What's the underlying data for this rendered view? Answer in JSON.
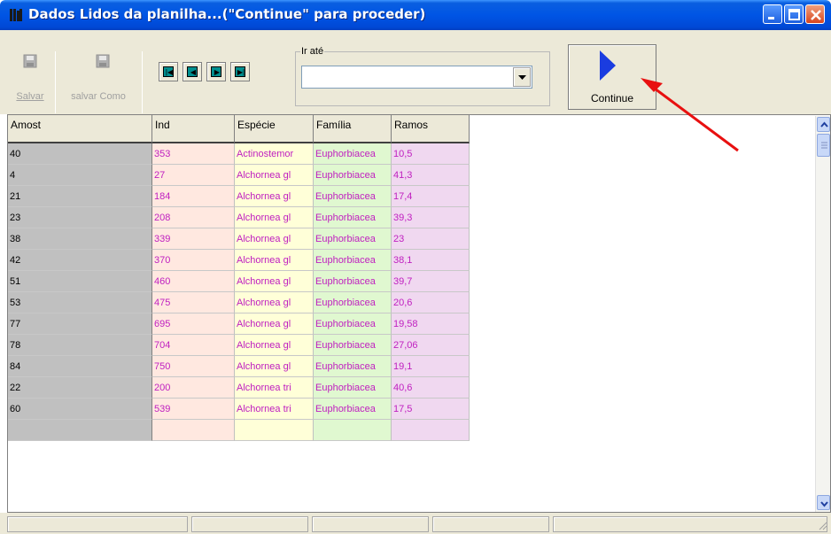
{
  "window": {
    "title": "Dados Lidos da planilha...(\"Continue\" para proceder)"
  },
  "toolbar": {
    "save_label": "Salvar",
    "save_as_label": "salvar Como",
    "goto_label": "Ir até",
    "goto_value": "",
    "continue_label": "Continue"
  },
  "grid": {
    "columns": [
      "Amost",
      "Ind",
      "Espécie",
      "Família",
      "Ramos"
    ],
    "rows": [
      [
        "40",
        "353",
        "Actinostemor",
        "Euphorbiacea",
        "10,5"
      ],
      [
        "4",
        "27",
        "Alchornea gl",
        "Euphorbiacea",
        "41,3"
      ],
      [
        "21",
        "184",
        "Alchornea gl",
        "Euphorbiacea",
        "17,4"
      ],
      [
        "23",
        "208",
        "Alchornea gl",
        "Euphorbiacea",
        "39,3"
      ],
      [
        "38",
        "339",
        "Alchornea gl",
        "Euphorbiacea",
        "23"
      ],
      [
        "42",
        "370",
        "Alchornea gl",
        "Euphorbiacea",
        "38,1"
      ],
      [
        "51",
        "460",
        "Alchornea gl",
        "Euphorbiacea",
        "39,7"
      ],
      [
        "53",
        "475",
        "Alchornea gl",
        "Euphorbiacea",
        "20,6"
      ],
      [
        "77",
        "695",
        "Alchornea gl",
        "Euphorbiacea",
        "19,58"
      ],
      [
        "78",
        "704",
        "Alchornea gl",
        "Euphorbiacea",
        "27,06"
      ],
      [
        "84",
        "750",
        "Alchornea gl",
        "Euphorbiacea",
        "19,1"
      ],
      [
        "22",
        "200",
        "Alchornea tri",
        "Euphorbiacea",
        "40,6"
      ],
      [
        "60",
        "539",
        "Alchornea tri",
        "Euphorbiacea",
        "17,5"
      ]
    ]
  },
  "colors": {
    "titlebar": "#0055e5",
    "cell_text": "#c020c0",
    "annotation_arrow": "#e81010",
    "continue_triangle": "#1a3ce0"
  }
}
